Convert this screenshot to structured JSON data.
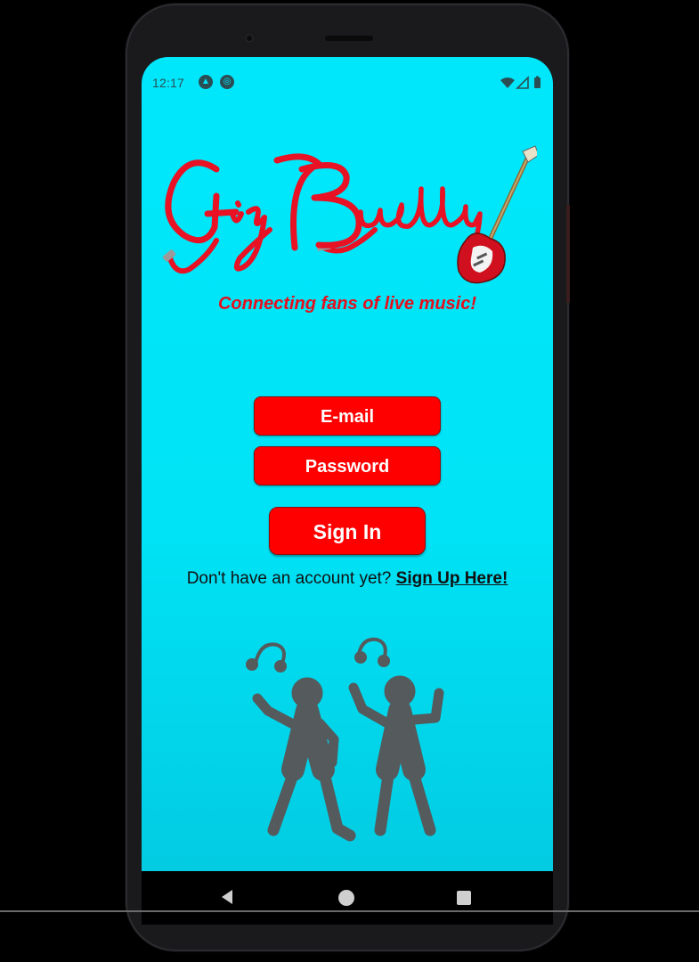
{
  "status_bar": {
    "time": "12:17",
    "icons": [
      "app-notification-icon",
      "sync-icon"
    ],
    "right_icons": [
      "wifi-icon",
      "signal-icon",
      "battery-icon"
    ]
  },
  "brand": {
    "logo_text": "Gig Buddy",
    "tagline": "Connecting fans of live music!",
    "primary_color": "#ff0000",
    "background_color": "#00e5fa"
  },
  "form": {
    "email_label": "E-mail",
    "password_label": "Password",
    "signin_label": "Sign In",
    "signup_prompt": "Don't have an account yet?",
    "signup_link": "Sign Up Here!"
  },
  "navigation": [
    "back-icon",
    "home-icon",
    "recents-icon"
  ]
}
